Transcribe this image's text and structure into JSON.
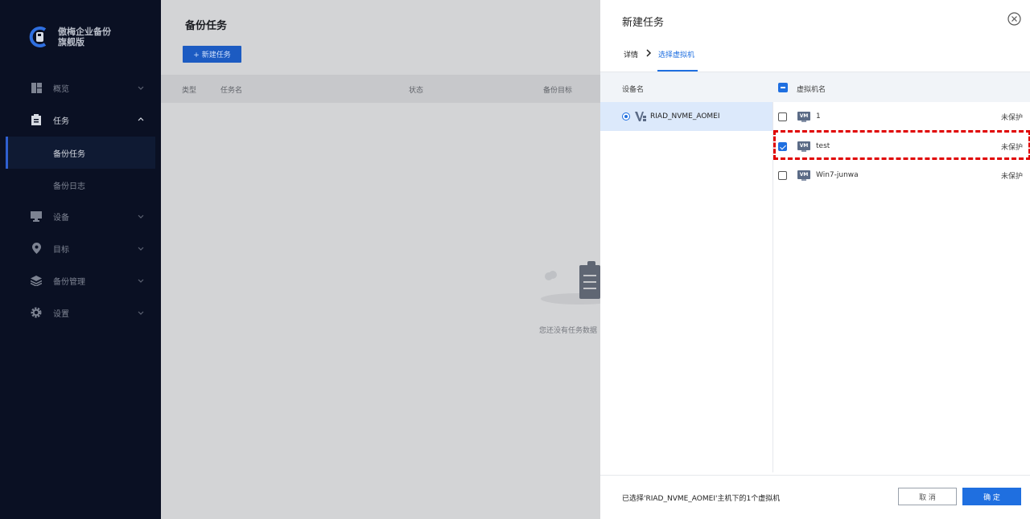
{
  "sidebar": {
    "brand_line1": "傲梅企业备份",
    "brand_line2": "旗舰版",
    "nav": [
      {
        "label": "概览",
        "icon": "dashboard-icon"
      },
      {
        "label": "任务",
        "icon": "clipboard-icon"
      },
      {
        "label": "设备",
        "icon": "monitor-icon"
      },
      {
        "label": "目标",
        "icon": "location-pin-icon"
      },
      {
        "label": "备份管理",
        "icon": "layers-icon"
      },
      {
        "label": "设置",
        "icon": "gear-icon"
      }
    ],
    "sub_items": [
      {
        "label": "备份任务",
        "active": true
      },
      {
        "label": "备份日志",
        "active": false
      }
    ]
  },
  "main": {
    "title": "备份任务",
    "new_task_label": "+ 新建任务",
    "columns": [
      "类型",
      "任务名",
      "状态",
      "备份目标"
    ],
    "empty_text": "您还没有任务数据"
  },
  "dialog": {
    "title": "新建任务",
    "breadcrumb": {
      "step1": "详情",
      "step2": "选择虚拟机"
    },
    "device_header": "设备名",
    "vm_header": "虚拟机名",
    "devices": [
      {
        "name": "RIAD_NVME_AOMEI",
        "selected": true
      }
    ],
    "vms": [
      {
        "name": "1",
        "badge": "VM",
        "status": "未保护",
        "checked": false
      },
      {
        "name": "test",
        "badge": "VM",
        "status": "未保护",
        "checked": true
      },
      {
        "name": "Win7-junwa",
        "badge": "VM",
        "status": "未保护",
        "checked": false
      }
    ],
    "footer_text": "已选择'RIAD_NVME_AOMEI'主机下的1个虚拟机",
    "cancel_label": "取 消",
    "ok_label": "确 定"
  },
  "colors": {
    "accent": "#1f6fe0",
    "sidebar_bg": "#0a1023",
    "highlight": "#e00000"
  }
}
